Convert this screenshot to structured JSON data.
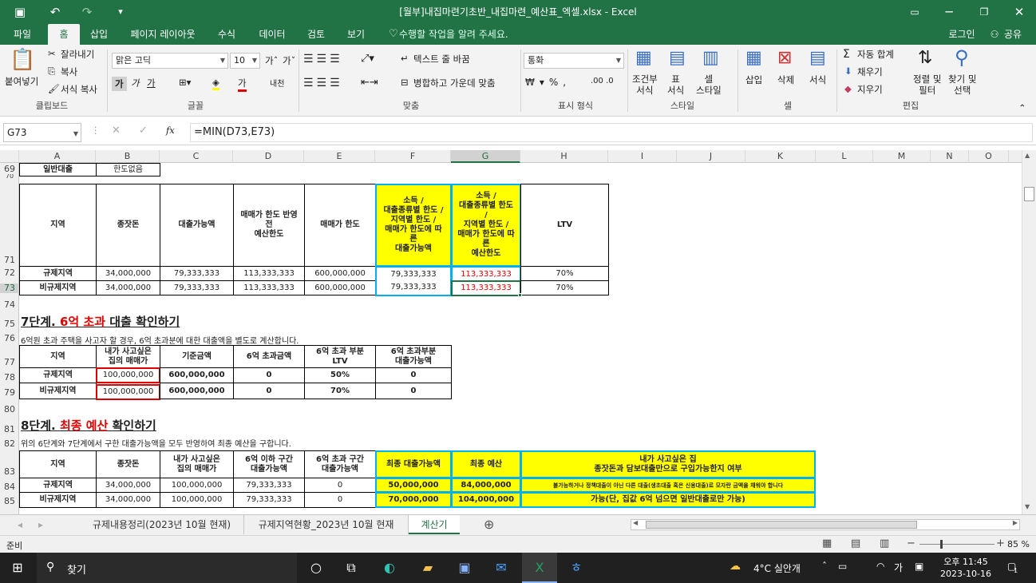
{
  "title_bar": {
    "title": "[월부]내집마련기초반_내집마련_예산표_엑셀.xlsx - Excel",
    "save_icon": "save-icon",
    "undo_icon": "undo-icon",
    "redo_icon": "redo-icon"
  },
  "tabs": {
    "file": "파일",
    "home": "홈",
    "insert": "삽입",
    "page_layout": "페이지 레이아웃",
    "formulas": "수식",
    "data": "데이터",
    "review": "검토",
    "view": "보기",
    "tell_me": "수행할 작업을 알려 주세요.",
    "login": "로그인",
    "share": "공유"
  },
  "ribbon": {
    "clipboard": {
      "paste": "붙여넣기",
      "cut": "잘라내기",
      "copy": "복사",
      "format_painter": "서식 복사",
      "group": "클립보드"
    },
    "font": {
      "name": "맑은 고딕",
      "size": "10",
      "bold": "가",
      "italic": "가",
      "underline": "가",
      "font_color_label": "가",
      "phonetic": "내천",
      "group": "글꼴"
    },
    "alignment": {
      "wrap": "텍스트 줄 바꿈",
      "merge": "병합하고 가운데 맞춤",
      "group": "맞춤"
    },
    "number": {
      "format": "통화",
      "group": "표시 형식"
    },
    "styles": {
      "conditional": "조건부\n서식",
      "table": "표\n서식",
      "cell_style": "셀\n스타일",
      "group": "스타일"
    },
    "cells": {
      "insert": "삽입",
      "delete": "삭제",
      "format": "서식",
      "group": "셀"
    },
    "editing": {
      "autosum": "자동 합계",
      "fill": "채우기",
      "clear": "지우기",
      "sort": "정렬 및\n필터",
      "find": "찾기 및\n선택",
      "group": "편집"
    }
  },
  "formula_bar": {
    "name_box": "G73",
    "formula": "=MIN(D73,E73)",
    "fx": "fx"
  },
  "columns": [
    "A",
    "B",
    "C",
    "D",
    "E",
    "F",
    "G",
    "H",
    "I",
    "J",
    "K",
    "L",
    "M",
    "N",
    "O"
  ],
  "rows": [
    "69",
    "70",
    "71",
    "72",
    "73",
    "74",
    "75",
    "76",
    "77",
    "78",
    "79",
    "80",
    "81",
    "82",
    "83",
    "84",
    "85"
  ],
  "sheet": {
    "r69": {
      "a": "일반대출",
      "b": "한도없음"
    },
    "t1": {
      "headers": [
        "지역",
        "종잣돈",
        "대출가능액",
        "매매가 한도 반영\n전\n예산한도",
        "매매가 한도",
        "소득 /\n대출종류별 한도 /\n지역별 한도 /\n매매가 한도에 따\n른\n대출가능액",
        "소득 /\n대출종류별 한도\n/\n지역별 한도 /\n매매가 한도에 따\n른\n예산한도",
        "LTV"
      ],
      "rows": [
        [
          "규제지역",
          "34,000,000",
          "79,333,333",
          "113,333,333",
          "600,000,000",
          "79,333,333",
          "113,333,333",
          "70%"
        ],
        [
          "비규제지역",
          "34,000,000",
          "79,333,333",
          "113,333,333",
          "600,000,000",
          "79,333,333",
          "113,333,333",
          "70%"
        ]
      ]
    },
    "step7": {
      "title_a": "7단계. ",
      "title_b": "6억 초과",
      "title_c": " 대출 확인하기",
      "note": "6억원 초과 주택을 사고자 할 경우, 6억 초과분에 대한 대출액을 별도로 계산합니다.",
      "headers": [
        "지역",
        "내가 사고싶은\n집의 매매가",
        "기준금액",
        "6억 초과금액",
        "6억 초과 부분\nLTV",
        "6억 초과부분\n대출가능액"
      ],
      "rows": [
        [
          "규제지역",
          "100,000,000",
          "600,000,000",
          "0",
          "50%",
          "0"
        ],
        [
          "비규제지역",
          "100,000,000",
          "600,000,000",
          "0",
          "70%",
          "0"
        ]
      ]
    },
    "step8": {
      "title_a": "8단계. ",
      "title_b": "최종 예산",
      "title_c": " 확인하기",
      "note": "위의 6단계와 7단계에서 구한 대출가능액을 모두 반영하여 최종 예산을 구합니다.",
      "headers": [
        "지역",
        "종잣돈",
        "내가 사고싶은\n집의 매매가",
        "6억 이하 구간\n대출가능액",
        "6억 초과 구간\n대출가능액",
        "최종 대출가능액",
        "최종 예산",
        "내가 사고싶은 집\n종잣돈과 담보대출만으로 구입가능한지 여부"
      ],
      "rows": [
        [
          "규제지역",
          "34,000,000",
          "100,000,000",
          "79,333,333",
          "0",
          "50,000,000",
          "84,000,000",
          "불가능하거나 정책대출이 아닌 다른 대출(생초대출 혹은 신용대출)로 모자란 금액을 채워야 합니다"
        ],
        [
          "비규제지역",
          "34,000,000",
          "100,000,000",
          "79,333,333",
          "0",
          "70,000,000",
          "104,000,000",
          "가능(단, 집값 6억 넘으면 일반대출로만 가능)"
        ]
      ]
    }
  },
  "sheet_tabs": [
    "규제내용정리(2023년 10월 현재)",
    "규제지역현황_2023년 10월 현재",
    "계산기"
  ],
  "status": {
    "ready": "준비",
    "zoom": "85 %"
  },
  "taskbar": {
    "search": "찾기",
    "weather": "4°C 실안개",
    "time": "오후 11:45",
    "date": "2023-10-16",
    "lang": "가",
    "notif": "1"
  }
}
